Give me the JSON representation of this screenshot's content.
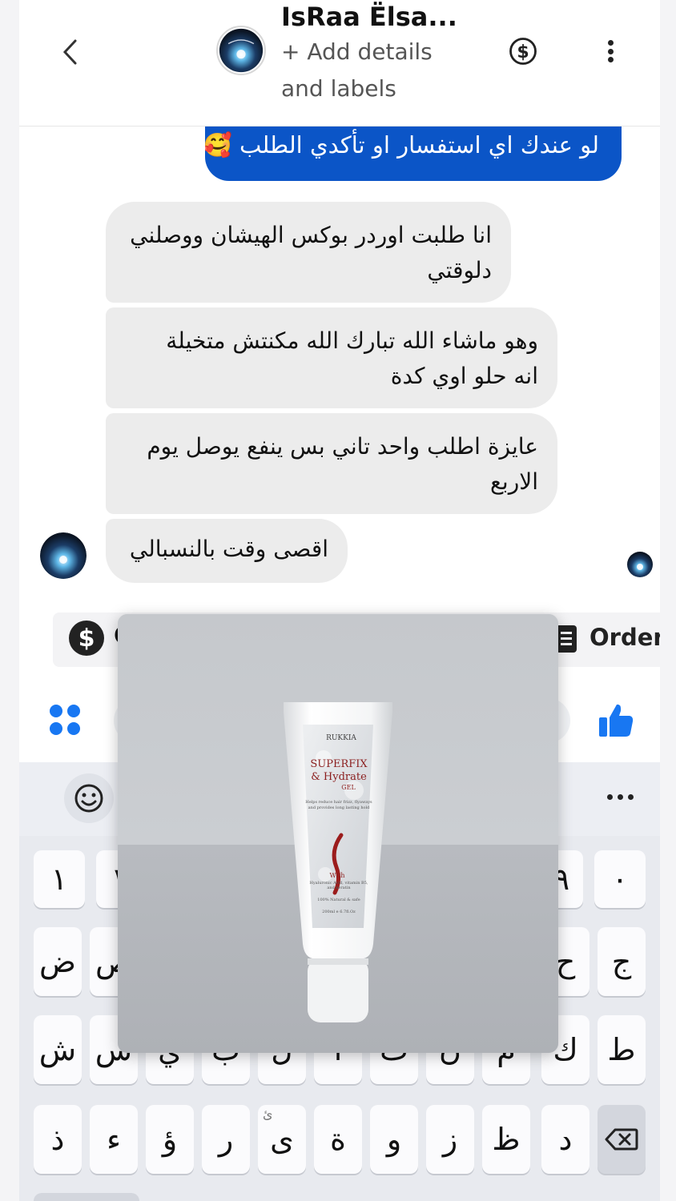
{
  "header": {
    "contact_name": "IsRaa Ëlsa...",
    "add_details_line1": "+ Add details",
    "add_details_line2": "and labels"
  },
  "messages": {
    "outgoing_last": "لو عندك اي استفسار او تأكدي الطلب",
    "outgoing_emoji": "🥰",
    "incoming": [
      {
        "line1": "انا طلبت اوردر بوكس الهيشان ووصلني",
        "line2": "دلوقتي"
      },
      {
        "line1": "وهو ماشاء الله تبارك الله مكنتش متخيلة",
        "line2": "انه حلو اوي كدة"
      },
      {
        "line1": "عايزة اطلب واحد تاني بس ينفع يوصل يوم",
        "line2": "الاربع"
      },
      {
        "line1": "اقصى وقت بالنسبالي",
        "line2": ""
      }
    ]
  },
  "quick_actions": {
    "payment_icon": "dollar-circle-icon",
    "partial_label": "C",
    "order_label": "Order"
  },
  "keyboard": {
    "row_numbers": [
      "١",
      "٢",
      "٠"
    ],
    "row_partial_number": "٩",
    "row1": [
      "ض",
      "ص",
      "ح",
      "ج"
    ],
    "row2": [
      "ش",
      "س",
      "ي",
      "ب",
      "ل",
      "ا",
      "ت",
      "ن",
      "م",
      "ك",
      "ط"
    ],
    "row3": [
      "ذ",
      "ء",
      "ؤ",
      "ر",
      "ى",
      "ة",
      "و",
      "ز",
      "ظ",
      "د"
    ],
    "row3_hint": "ئ"
  },
  "product_preview": {
    "brand": "RUKKIA",
    "title_line1": "SUPERFIX",
    "title_line2": "& Hydrate",
    "title_line3": "GEL",
    "desc": "Helps reduce hair frizz, flyaways and provides long lasting hold",
    "with_label": "With",
    "ingredients": "Hyaluronic Acid, vitamin B5, and keratin",
    "claims": "100% Natural & safe",
    "volume": "200ml e 6.7fl.Oz"
  },
  "colors": {
    "messenger_blue": "#0b55c7",
    "incoming_bubble": "#ececec",
    "accent": "#1877f2"
  }
}
